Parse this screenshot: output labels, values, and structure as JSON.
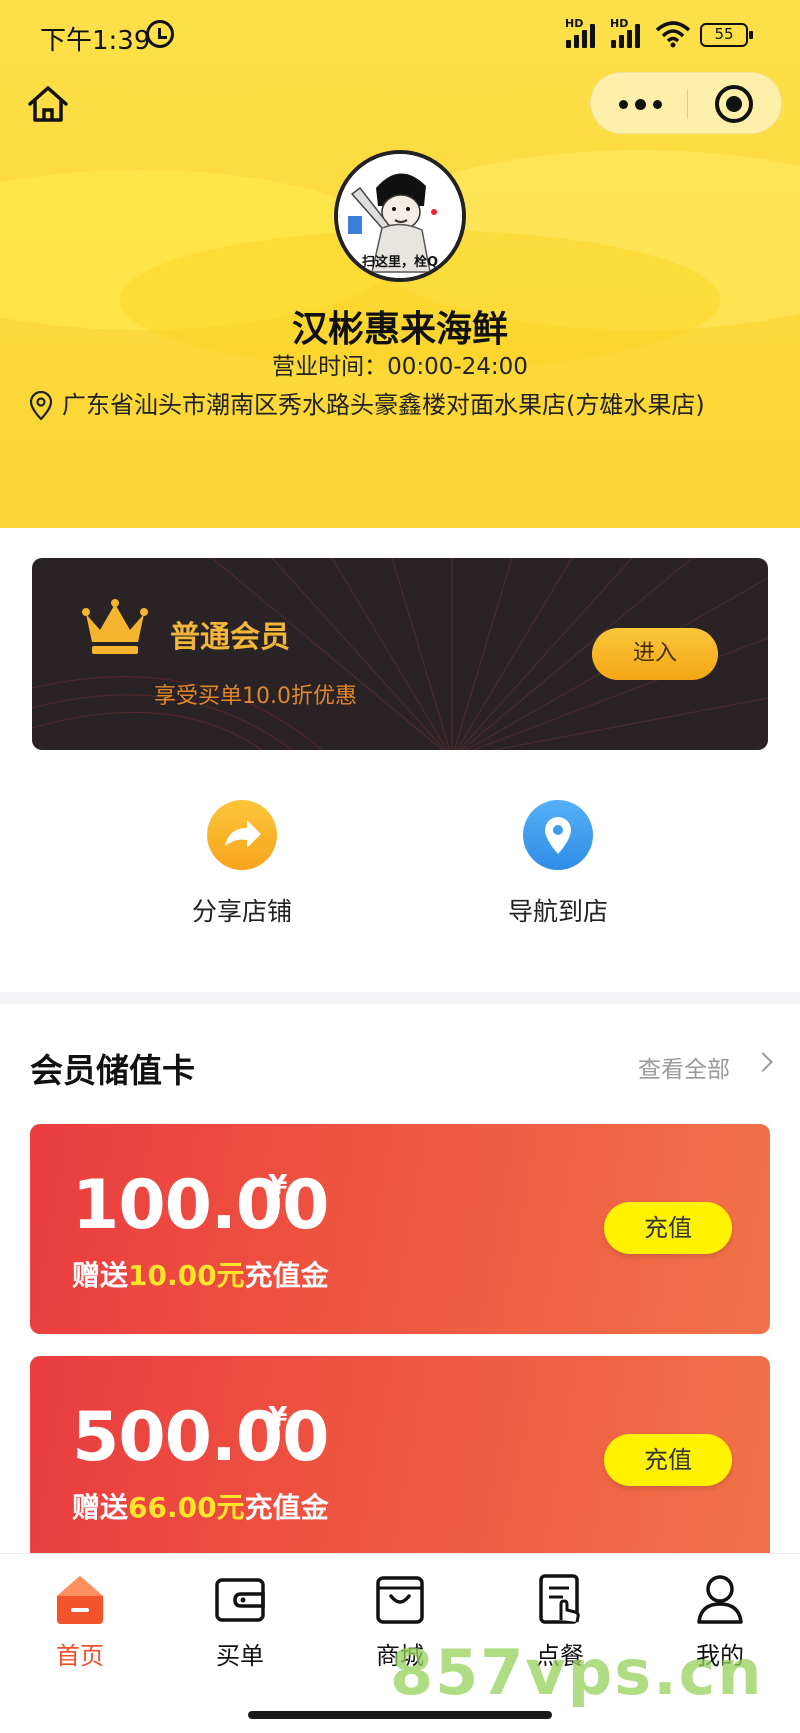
{
  "status_bar": {
    "time": "下午1:39",
    "network_label_1": "HD",
    "network_label_2": "HD",
    "battery": "55"
  },
  "nav": {
    "home_icon": "home-icon",
    "more_icon": "more-dots-icon",
    "close_icon": "target-close-icon"
  },
  "store": {
    "name": "汉彬惠来海鲜",
    "hours": "营业时间：00:00-24:00",
    "address": "广东省汕头市潮南区秀水路头豪鑫楼对面水果店(方雄水果店)",
    "avatar_caption": "扫这里，栓Q"
  },
  "member": {
    "title": "普通会员",
    "description": "享受买单10.0折优惠",
    "enter_label": "进入"
  },
  "actions": [
    {
      "label": "分享店铺",
      "icon": "share-arrow-icon",
      "color": "#fbb72c"
    },
    {
      "label": "导航到店",
      "icon": "location-pin-icon",
      "color": "#3a9bf0"
    }
  ],
  "cards_section": {
    "title": "会员储值卡",
    "view_all": "查看全部"
  },
  "value_cards": [
    {
      "amount": "100.00",
      "currency": "¥",
      "bonus_prefix": "赠送",
      "bonus_amount": "10.00元",
      "bonus_suffix": "充值金",
      "button": "充值"
    },
    {
      "amount": "500.00",
      "currency": "¥",
      "bonus_prefix": "赠送",
      "bonus_amount": "66.00元",
      "bonus_suffix": "充值金",
      "button": "充值"
    }
  ],
  "tabs": [
    {
      "label": "首页",
      "icon": "home-tab-icon",
      "active": true
    },
    {
      "label": "买单",
      "icon": "wallet-icon",
      "active": false
    },
    {
      "label": "商城",
      "icon": "shopping-bag-icon",
      "active": false
    },
    {
      "label": "点餐",
      "icon": "order-menu-icon",
      "active": false
    },
    {
      "label": "我的",
      "icon": "user-profile-icon",
      "active": false
    }
  ],
  "colors": {
    "header_yellow": "#fcd93a",
    "accent_orange": "#f0512d",
    "card_red": "#ea3d40",
    "button_yellow": "#fff200",
    "member_gold": "#f2b63a"
  },
  "watermark": "857vps.cn"
}
